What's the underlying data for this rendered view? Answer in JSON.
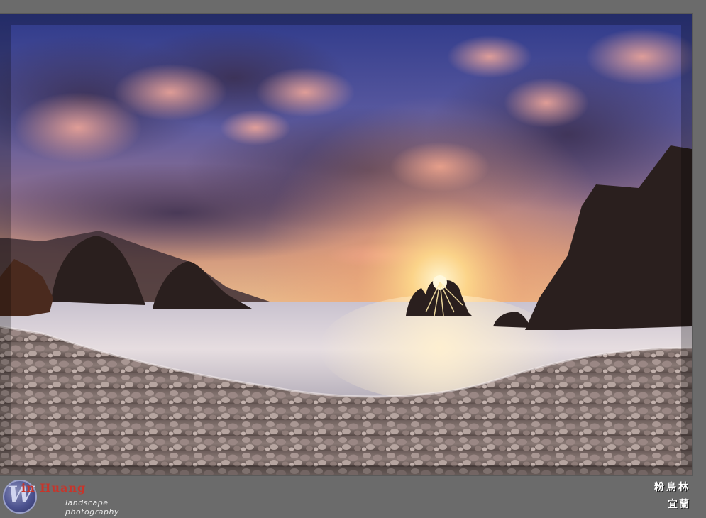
{
  "photo": {
    "subject": "sunset-seascape",
    "colors": {
      "sky_top": "#3a3f86",
      "sky_mid": "#8a7fb0",
      "sky_glow": "#f6c07a",
      "sun": "#fff3c4",
      "water": "#cfc9d2",
      "rock": "#2a1f1c",
      "pebble": "#8d7f7a"
    }
  },
  "watermark": {
    "mark_letter": "W",
    "brand": "in Huang",
    "tagline": "landscape photography"
  },
  "caption": {
    "line1": "粉鳥林",
    "line2": "宜蘭"
  },
  "page": {
    "background": "#6b6b6b"
  }
}
